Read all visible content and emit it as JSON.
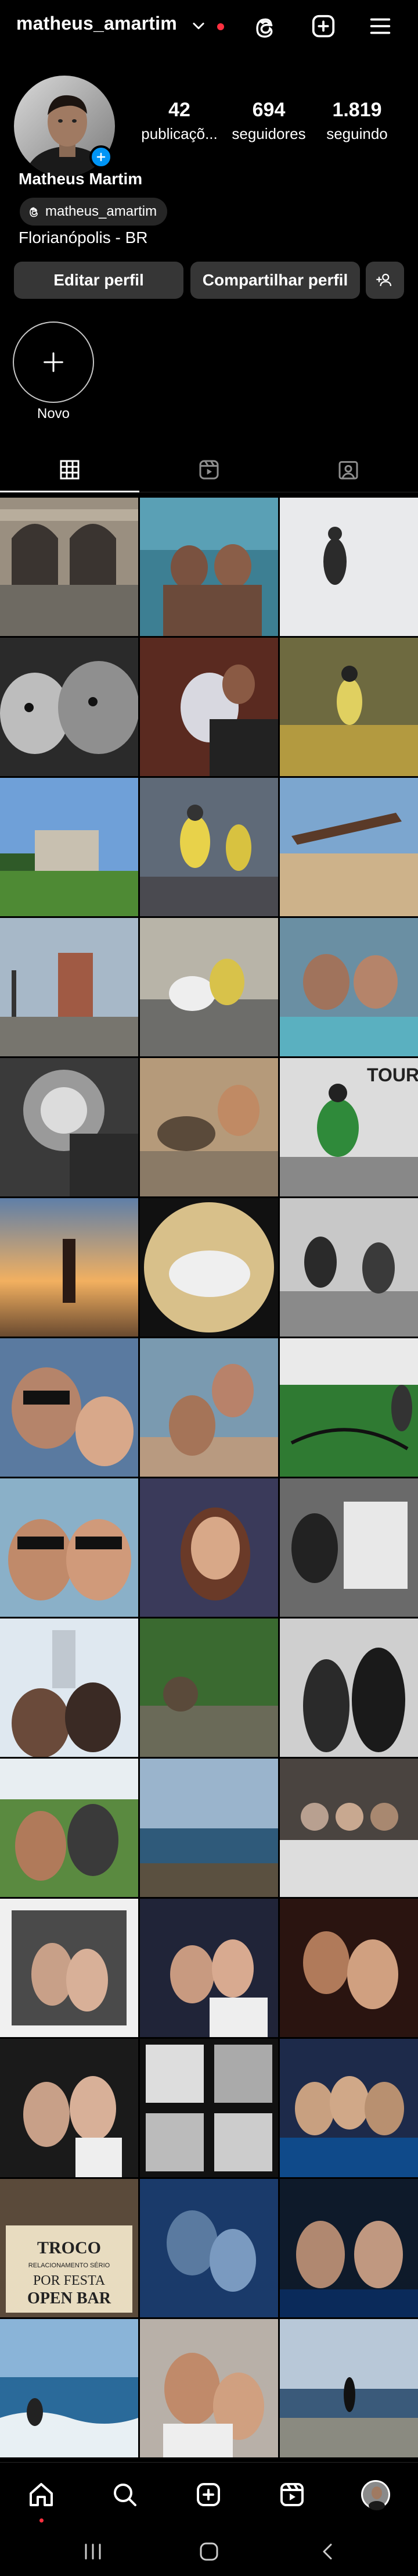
{
  "header": {
    "username": "matheus_amartim"
  },
  "profile": {
    "name": "Matheus Martim",
    "threads_handle": "matheus_amartim",
    "location": "Florianópolis - BR",
    "stats": [
      {
        "value": "42",
        "label": "publicaçõ..."
      },
      {
        "value": "694",
        "label": "seguidores"
      },
      {
        "value": "1.819",
        "label": "seguindo"
      }
    ],
    "edit_button": "Editar perfil",
    "share_button": "Compartilhar perfil",
    "new_highlight_label": "Novo"
  },
  "tabs": [
    {
      "icon": "grid-icon",
      "active": true
    },
    {
      "icon": "reels-icon",
      "active": false
    },
    {
      "icon": "tagged-icon",
      "active": false
    }
  ],
  "grid_posts": [
    {
      "desc": "arches-graffiti"
    },
    {
      "desc": "two-men-pool"
    },
    {
      "desc": "snow-person"
    },
    {
      "desc": "dogs-bw"
    },
    {
      "desc": "dog-with-man"
    },
    {
      "desc": "hockey-gym"
    },
    {
      "desc": "field-building"
    },
    {
      "desc": "hockey-players"
    },
    {
      "desc": "beach-pushup"
    },
    {
      "desc": "town-square"
    },
    {
      "desc": "hockey-pile"
    },
    {
      "desc": "couple-pool"
    },
    {
      "desc": "man-sun-bw"
    },
    {
      "desc": "group-pushups"
    },
    {
      "desc": "hockey-tour"
    },
    {
      "desc": "beach-handstand"
    },
    {
      "desc": "fisheye-jump"
    },
    {
      "desc": "hockey-bw"
    },
    {
      "desc": "selfie-sunglasses"
    },
    {
      "desc": "couple-beach"
    },
    {
      "desc": "battle-ropes"
    },
    {
      "desc": "couple-sunglasses"
    },
    {
      "desc": "woman-smile"
    },
    {
      "desc": "documents-bw"
    },
    {
      "desc": "selfie-tower"
    },
    {
      "desc": "man-sitting-rocks"
    },
    {
      "desc": "couple-bw"
    },
    {
      "desc": "selfie-trees"
    },
    {
      "desc": "coast-view"
    },
    {
      "desc": "group-bw"
    },
    {
      "desc": "framed-photo"
    },
    {
      "desc": "couple-night"
    },
    {
      "desc": "couple-dark"
    },
    {
      "desc": "couple-white"
    },
    {
      "desc": "photobooth-bw"
    },
    {
      "desc": "group-party"
    },
    {
      "desc": "troco-sign"
    },
    {
      "desc": "couple-blue"
    },
    {
      "desc": "two-men-party"
    },
    {
      "desc": "surfer"
    },
    {
      "desc": "couple-selfie"
    },
    {
      "desc": "beach-walk"
    }
  ],
  "sign_text": {
    "line1": "TROCO",
    "line2": "RELACIONAMENTO SÉRIO",
    "line3": "POR FESTA",
    "line4": "OPEN BAR"
  },
  "tour_text": "TOUR",
  "colors": {
    "accent_blue": "#0095f6",
    "notification_red": "#ff3040",
    "button_bg": "#363636",
    "chip_bg": "#262626"
  }
}
